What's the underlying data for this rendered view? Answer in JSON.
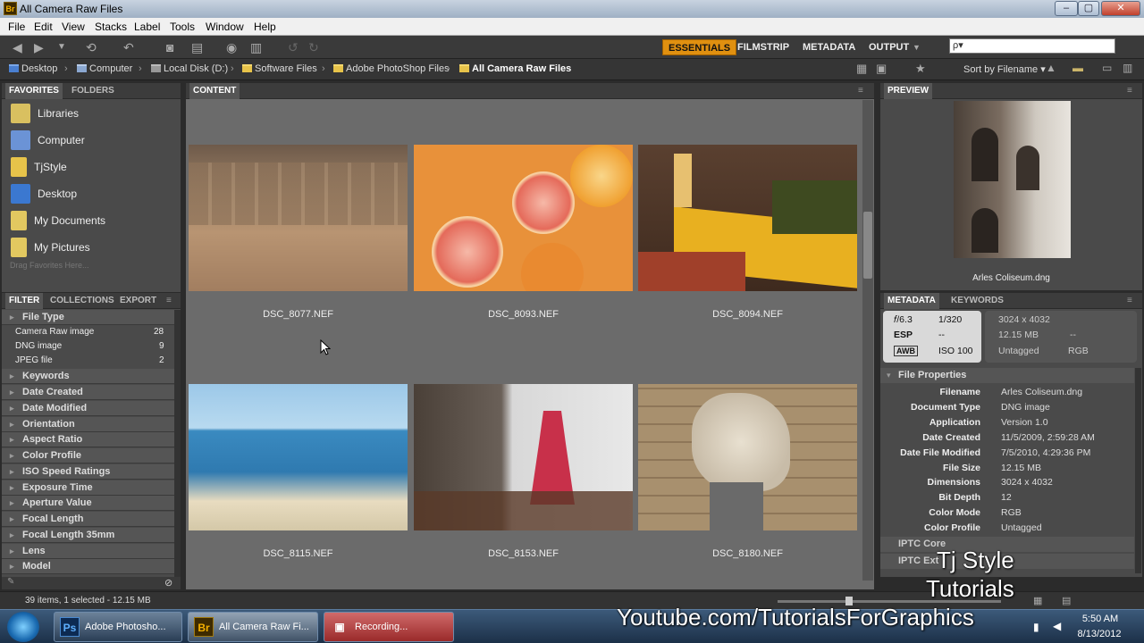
{
  "window": {
    "title": "All Camera Raw Files",
    "app_badge": "Br"
  },
  "menu": [
    "File",
    "Edit",
    "View",
    "Stacks",
    "Label",
    "Tools",
    "Window",
    "Help"
  ],
  "workspaces": [
    "ESSENTIALS",
    "FILMSTRIP",
    "METADATA",
    "OUTPUT"
  ],
  "search": {
    "placeholder": "ρ▾"
  },
  "path": [
    "Desktop",
    "Computer",
    "Local Disk (D:)",
    "Software Files",
    "Adobe PhotoShop Files",
    "All Camera Raw Files"
  ],
  "sort_label": "Sort by Filename",
  "left_tabs": {
    "favorites": "FAVORITES",
    "folders": "FOLDERS"
  },
  "favorites": [
    "Libraries",
    "Computer",
    "TjStyle",
    "Desktop",
    "My Documents",
    "My Pictures"
  ],
  "favorites_hint": "Drag Favorites Here...",
  "filter_tabs": {
    "filter": "FILTER",
    "collections": "COLLECTIONS",
    "export": "EXPORT"
  },
  "filter": {
    "file_type_label": "File Type",
    "file_types": [
      {
        "name": "Camera Raw image",
        "count": "28"
      },
      {
        "name": "DNG image",
        "count": "9"
      },
      {
        "name": "JPEG file",
        "count": "2"
      }
    ],
    "categories": [
      "Keywords",
      "Date Created",
      "Date Modified",
      "Orientation",
      "Aspect Ratio",
      "Color Profile",
      "ISO Speed Ratings",
      "Exposure Time",
      "Aperture Value",
      "Focal Length",
      "Focal Length 35mm",
      "Lens",
      "Model"
    ]
  },
  "content_tab": "CONTENT",
  "thumbnails": [
    "DSC_8077.NEF",
    "DSC_8093.NEF",
    "DSC_8094.NEF",
    "DSC_8115.NEF",
    "DSC_8153.NEF",
    "DSC_8180.NEF"
  ],
  "preview": {
    "tab": "PREVIEW",
    "caption": "Arles Coliseum.dng"
  },
  "meta_tabs": {
    "metadata": "METADATA",
    "keywords": "KEYWORDS"
  },
  "camera_info": {
    "aperture": "𝑓/6.3",
    "shutter": "1/320",
    "exposure": "ESP",
    "exposure_comp": "--",
    "wb": "AWB",
    "iso": "ISO 100",
    "dims": "3024 x 4032",
    "size": "12.15 MB",
    "dash": "--",
    "tag": "Untagged",
    "mode": "RGB"
  },
  "file_properties": {
    "label": "File Properties",
    "rows": [
      {
        "k": "Filename",
        "v": "Arles Coliseum.dng"
      },
      {
        "k": "Document Type",
        "v": "DNG image"
      },
      {
        "k": "Application",
        "v": "Version 1.0"
      },
      {
        "k": "Date Created",
        "v": "11/5/2009, 2:59:28 AM"
      },
      {
        "k": "Date File Modified",
        "v": "7/5/2010, 4:29:36 PM"
      },
      {
        "k": "File Size",
        "v": "12.15 MB"
      },
      {
        "k": "Dimensions",
        "v": "3024 x 4032"
      },
      {
        "k": "Bit Depth",
        "v": "12"
      },
      {
        "k": "Color Mode",
        "v": "RGB"
      },
      {
        "k": "Color Profile",
        "v": "Untagged"
      }
    ]
  },
  "iptc": [
    "IPTC Core",
    "IPTC Ext"
  ],
  "status": "39 items, 1 selected - 12.15 MB",
  "taskbar": {
    "items": [
      "Adobe Photosho...",
      "All Camera Raw Fi...",
      "Recording..."
    ],
    "time": "5:50 AM",
    "date": "8/13/2012"
  },
  "watermark": {
    "line1": "Tj Style",
    "line2": "Tutorials",
    "line3": "Youtube.com/TutorialsForGraphics"
  }
}
